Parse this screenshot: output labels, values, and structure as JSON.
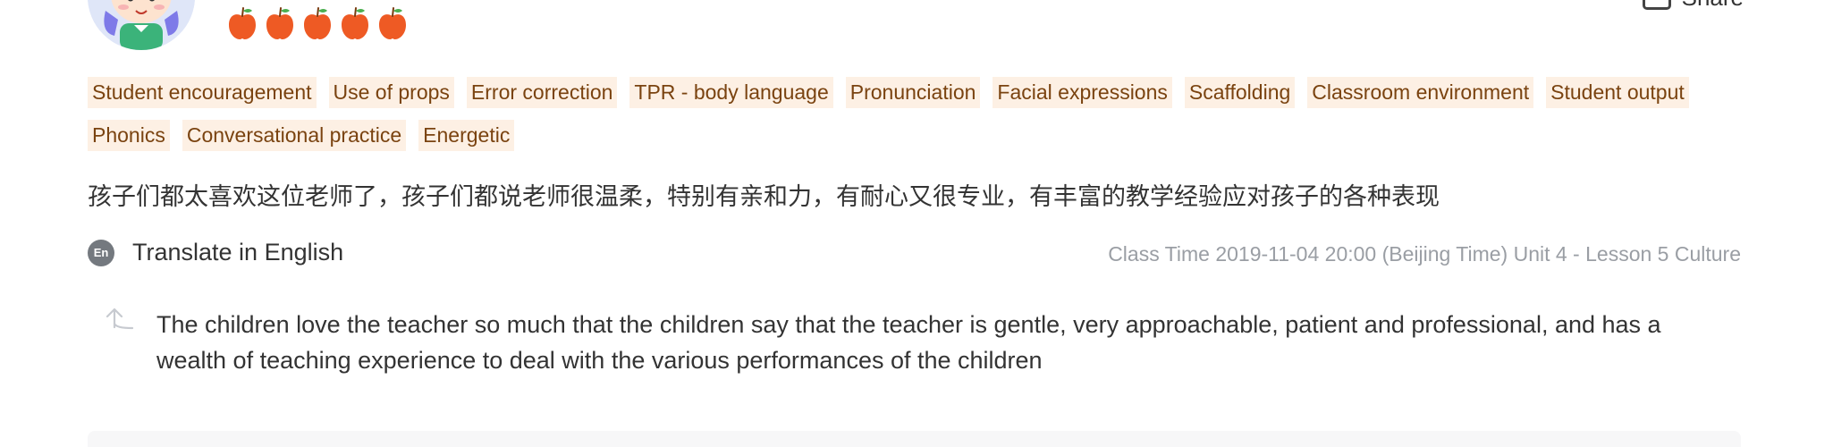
{
  "header": {
    "rating": {
      "score": 5,
      "max": 5,
      "icon": "apple-icon",
      "color": "#ee5a24"
    },
    "share_label": "Share"
  },
  "tags": [
    "Student encouragement",
    "Use of props",
    "Error correction",
    "TPR - body language",
    "Pronunciation",
    "Facial expressions",
    "Scaffolding",
    "Classroom environment",
    "Student output",
    "Phonics",
    "Conversational practice",
    "Energetic"
  ],
  "review": {
    "text": "孩子们都太喜欢这位老师了，孩子们都说老师很温柔，特别有亲和力，有耐心又很专业，有丰富的教学经验应对孩子的各种表现",
    "translate_badge": "En",
    "translate_label": "Translate in English",
    "class_info": "Class Time 2019-11-04 20:00 (Beijing Time) Unit 4 - Lesson 5 Culture",
    "translation": "The children love the teacher so much that the children say that the teacher is gentle, very approachable, patient and professional, and has a wealth of teaching experience to deal with the various performances of the children"
  },
  "colors": {
    "tag_bg": "#fdf0e4",
    "tag_text": "#7a4310",
    "muted_text": "#9a9ea4",
    "apple": "#ee5a24"
  }
}
